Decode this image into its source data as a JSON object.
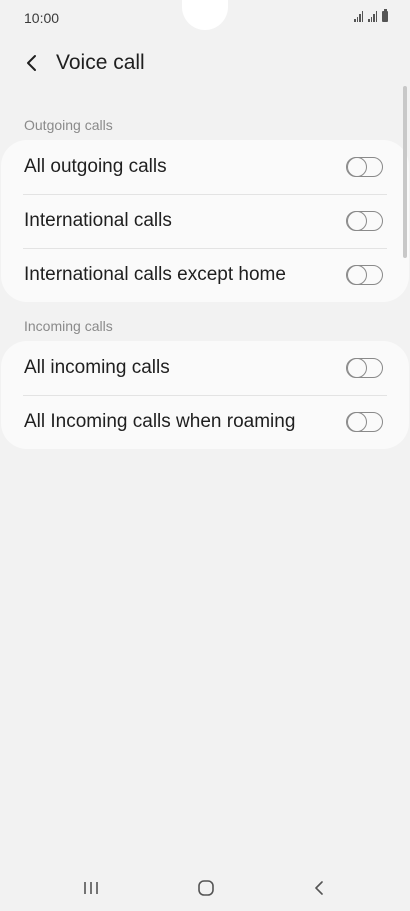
{
  "status_bar": {
    "time": "10:00",
    "icons": [
      "signal-icon",
      "signal-icon",
      "battery-icon"
    ]
  },
  "header": {
    "back_icon": "chevron-left-icon",
    "title": "Voice call"
  },
  "sections": [
    {
      "label": "Outgoing calls",
      "items": [
        {
          "label": "All outgoing calls",
          "enabled": false
        },
        {
          "label": "International calls",
          "enabled": false
        },
        {
          "label": "International calls except home",
          "enabled": false
        }
      ]
    },
    {
      "label": "Incoming calls",
      "items": [
        {
          "label": "All incoming calls",
          "enabled": false
        },
        {
          "label": "All Incoming calls when roaming",
          "enabled": false
        }
      ]
    }
  ],
  "nav_bar": {
    "recents_icon": "recents-icon",
    "home_icon": "home-icon",
    "back_icon": "back-icon"
  },
  "colors": {
    "background": "#f2f2f2",
    "card": "#fafafa",
    "toggle_off": "#8a8a8a"
  }
}
